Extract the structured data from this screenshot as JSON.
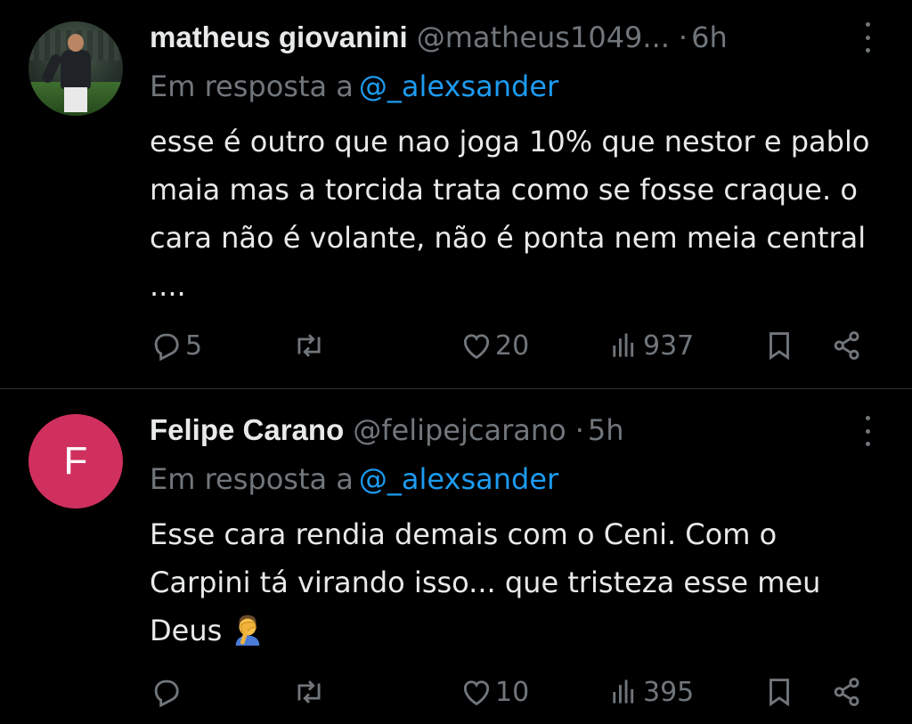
{
  "tweets": [
    {
      "name": "matheus giovanini",
      "handle": "@matheus1049...",
      "dot": "·",
      "time": "6h",
      "reply_prefix": "Em resposta a",
      "reply_mention": "@_alexsander",
      "text": "esse é outro que nao joga 10% que nestor e pablo maia mas a torcida trata como se fosse craque. o cara não é volante, não é ponta nem meia central ....",
      "replies": "5",
      "retweets": "",
      "likes": "20",
      "views": "937",
      "avatar": "photo"
    },
    {
      "name": "Felipe Carano",
      "handle": "@felipejcarano",
      "dot": "·",
      "time": "5h",
      "reply_prefix": "Em resposta a",
      "reply_mention": "@_alexsander",
      "text": "Esse cara rendia demais com o Ceni. Com o Carpini tá virando isso... que tristeza esse meu Deus",
      "replies": "",
      "retweets": "",
      "likes": "10",
      "views": "395",
      "avatar_letter": "F",
      "avatar_color": "#d0305e",
      "emoji": "facepalm-emoji"
    }
  ],
  "colors": {
    "background": "#000000",
    "text": "#e7e9ea",
    "muted": "#71767b",
    "link": "#1d9bf0",
    "divider": "#2f3336"
  }
}
